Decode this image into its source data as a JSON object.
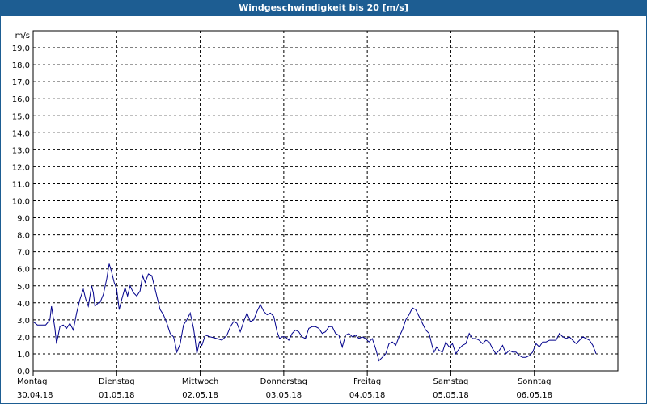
{
  "window": {
    "title": "Windgeschwindigkeit bis 20 [m/s]"
  },
  "colors": {
    "title_bar": "#1d5d92",
    "series": "#00008b",
    "grid": "#000000"
  },
  "chart_data": {
    "type": "line",
    "title": "Windgeschwindigkeit bis 20 [m/s]",
    "ylabel": "m/s",
    "ylim": [
      0,
      20
    ],
    "y_ticks": [
      "0,0",
      "1,0",
      "2,0",
      "3,0",
      "4,0",
      "5,0",
      "6,0",
      "7,0",
      "8,0",
      "9,0",
      "10,0",
      "11,0",
      "12,0",
      "13,0",
      "14,0",
      "15,0",
      "16,0",
      "17,0",
      "18,0",
      "19,0"
    ],
    "x_categories": [
      {
        "day": "Montag",
        "date": "30.04.18"
      },
      {
        "day": "Dienstag",
        "date": "01.05.18"
      },
      {
        "day": "Mittwoch",
        "date": "02.05.18"
      },
      {
        "day": "Donnerstag",
        "date": "03.05.18"
      },
      {
        "day": "Freitag",
        "date": "04.05.18"
      },
      {
        "day": "Samstag",
        "date": "05.05.18"
      },
      {
        "day": "Sonntag",
        "date": "06.05.18"
      }
    ],
    "xlim": [
      0,
      7
    ],
    "grid": true,
    "series": [
      {
        "points": [
          [
            0.0,
            2.9
          ],
          [
            0.05,
            2.7
          ],
          [
            0.1,
            2.7
          ],
          [
            0.15,
            2.7
          ],
          [
            0.2,
            3.0
          ],
          [
            0.22,
            3.8
          ],
          [
            0.26,
            2.5
          ],
          [
            0.28,
            1.6
          ],
          [
            0.32,
            2.6
          ],
          [
            0.36,
            2.7
          ],
          [
            0.4,
            2.5
          ],
          [
            0.44,
            2.8
          ],
          [
            0.48,
            2.4
          ],
          [
            0.52,
            3.4
          ],
          [
            0.56,
            4.2
          ],
          [
            0.6,
            4.8
          ],
          [
            0.63,
            4.2
          ],
          [
            0.66,
            3.8
          ],
          [
            0.7,
            5.0
          ],
          [
            0.72,
            4.6
          ],
          [
            0.74,
            3.8
          ],
          [
            0.78,
            4.0
          ],
          [
            0.8,
            4.0
          ],
          [
            0.84,
            4.5
          ],
          [
            0.88,
            5.4
          ],
          [
            0.91,
            6.3
          ],
          [
            0.94,
            5.8
          ],
          [
            0.97,
            5.2
          ],
          [
            1.0,
            4.8
          ],
          [
            1.03,
            3.6
          ],
          [
            1.06,
            4.2
          ],
          [
            1.1,
            4.9
          ],
          [
            1.13,
            4.4
          ],
          [
            1.16,
            5.0
          ],
          [
            1.2,
            4.6
          ],
          [
            1.24,
            4.4
          ],
          [
            1.28,
            4.7
          ],
          [
            1.31,
            5.6
          ],
          [
            1.34,
            5.2
          ],
          [
            1.38,
            5.7
          ],
          [
            1.42,
            5.6
          ],
          [
            1.46,
            4.8
          ],
          [
            1.52,
            3.6
          ],
          [
            1.56,
            3.3
          ],
          [
            1.6,
            2.8
          ],
          [
            1.64,
            2.2
          ],
          [
            1.68,
            2.0
          ],
          [
            1.7,
            1.6
          ],
          [
            1.72,
            1.1
          ],
          [
            1.76,
            1.6
          ],
          [
            1.8,
            2.7
          ],
          [
            1.84,
            3.0
          ],
          [
            1.88,
            3.4
          ],
          [
            1.92,
            2.5
          ],
          [
            1.94,
            1.8
          ],
          [
            1.96,
            1.0
          ],
          [
            1.99,
            1.7
          ],
          [
            2.02,
            1.5
          ],
          [
            2.06,
            2.1
          ],
          [
            2.12,
            2.0
          ],
          [
            2.2,
            1.9
          ],
          [
            2.26,
            1.8
          ],
          [
            2.32,
            2.1
          ],
          [
            2.36,
            2.6
          ],
          [
            2.4,
            2.9
          ],
          [
            2.44,
            2.8
          ],
          [
            2.48,
            2.3
          ],
          [
            2.52,
            2.9
          ],
          [
            2.56,
            3.4
          ],
          [
            2.6,
            2.9
          ],
          [
            2.64,
            3.0
          ],
          [
            2.68,
            3.5
          ],
          [
            2.72,
            3.9
          ],
          [
            2.76,
            3.5
          ],
          [
            2.8,
            3.3
          ],
          [
            2.84,
            3.4
          ],
          [
            2.88,
            3.2
          ],
          [
            2.92,
            2.3
          ],
          [
            2.95,
            1.9
          ],
          [
            2.98,
            2.0
          ],
          [
            3.02,
            2.0
          ],
          [
            3.06,
            1.8
          ],
          [
            3.1,
            2.2
          ],
          [
            3.14,
            2.4
          ],
          [
            3.18,
            2.3
          ],
          [
            3.22,
            2.0
          ],
          [
            3.26,
            1.9
          ],
          [
            3.3,
            2.5
          ],
          [
            3.34,
            2.6
          ],
          [
            3.38,
            2.6
          ],
          [
            3.42,
            2.5
          ],
          [
            3.46,
            2.2
          ],
          [
            3.5,
            2.3
          ],
          [
            3.54,
            2.6
          ],
          [
            3.58,
            2.6
          ],
          [
            3.62,
            2.2
          ],
          [
            3.66,
            2.1
          ],
          [
            3.7,
            1.4
          ],
          [
            3.74,
            2.1
          ],
          [
            3.78,
            2.2
          ],
          [
            3.82,
            2.0
          ],
          [
            3.86,
            2.1
          ],
          [
            3.9,
            1.9
          ],
          [
            3.94,
            2.0
          ],
          [
            3.98,
            1.9
          ],
          [
            4.02,
            1.7
          ],
          [
            4.06,
            1.9
          ],
          [
            4.1,
            1.3
          ],
          [
            4.14,
            0.6
          ],
          [
            4.18,
            0.8
          ],
          [
            4.22,
            1.0
          ],
          [
            4.26,
            1.6
          ],
          [
            4.3,
            1.7
          ],
          [
            4.34,
            1.5
          ],
          [
            4.38,
            2.0
          ],
          [
            4.42,
            2.4
          ],
          [
            4.46,
            3.0
          ],
          [
            4.5,
            3.3
          ],
          [
            4.54,
            3.7
          ],
          [
            4.58,
            3.6
          ],
          [
            4.62,
            3.2
          ],
          [
            4.66,
            2.8
          ],
          [
            4.7,
            2.4
          ],
          [
            4.74,
            2.2
          ],
          [
            4.78,
            1.4
          ],
          [
            4.8,
            1.1
          ],
          [
            4.83,
            1.4
          ],
          [
            4.86,
            1.2
          ],
          [
            4.9,
            1.1
          ],
          [
            4.94,
            1.7
          ],
          [
            4.98,
            1.4
          ],
          [
            5.02,
            1.6
          ],
          [
            5.06,
            1.0
          ],
          [
            5.1,
            1.3
          ],
          [
            5.14,
            1.5
          ],
          [
            5.18,
            1.6
          ],
          [
            5.22,
            2.2
          ],
          [
            5.26,
            1.9
          ],
          [
            5.3,
            1.9
          ],
          [
            5.34,
            1.8
          ],
          [
            5.38,
            1.6
          ],
          [
            5.42,
            1.8
          ],
          [
            5.46,
            1.7
          ],
          [
            5.5,
            1.3
          ],
          [
            5.54,
            1.0
          ],
          [
            5.58,
            1.2
          ],
          [
            5.62,
            1.5
          ],
          [
            5.66,
            1.0
          ],
          [
            5.7,
            1.2
          ],
          [
            5.74,
            1.1
          ],
          [
            5.78,
            1.1
          ],
          [
            5.82,
            0.9
          ],
          [
            5.86,
            0.8
          ],
          [
            5.9,
            0.8
          ],
          [
            5.94,
            0.9
          ],
          [
            5.98,
            1.1
          ],
          [
            6.02,
            1.6
          ],
          [
            6.06,
            1.4
          ],
          [
            6.1,
            1.7
          ],
          [
            6.14,
            1.7
          ],
          [
            6.18,
            1.8
          ],
          [
            6.22,
            1.8
          ],
          [
            6.26,
            1.8
          ],
          [
            6.3,
            2.2
          ],
          [
            6.34,
            2.0
          ],
          [
            6.38,
            1.9
          ],
          [
            6.42,
            2.0
          ],
          [
            6.46,
            1.8
          ],
          [
            6.5,
            1.6
          ],
          [
            6.54,
            1.8
          ],
          [
            6.58,
            2.0
          ],
          [
            6.62,
            1.9
          ],
          [
            6.66,
            1.8
          ],
          [
            6.7,
            1.5
          ],
          [
            6.74,
            1.0
          ]
        ]
      }
    ]
  }
}
